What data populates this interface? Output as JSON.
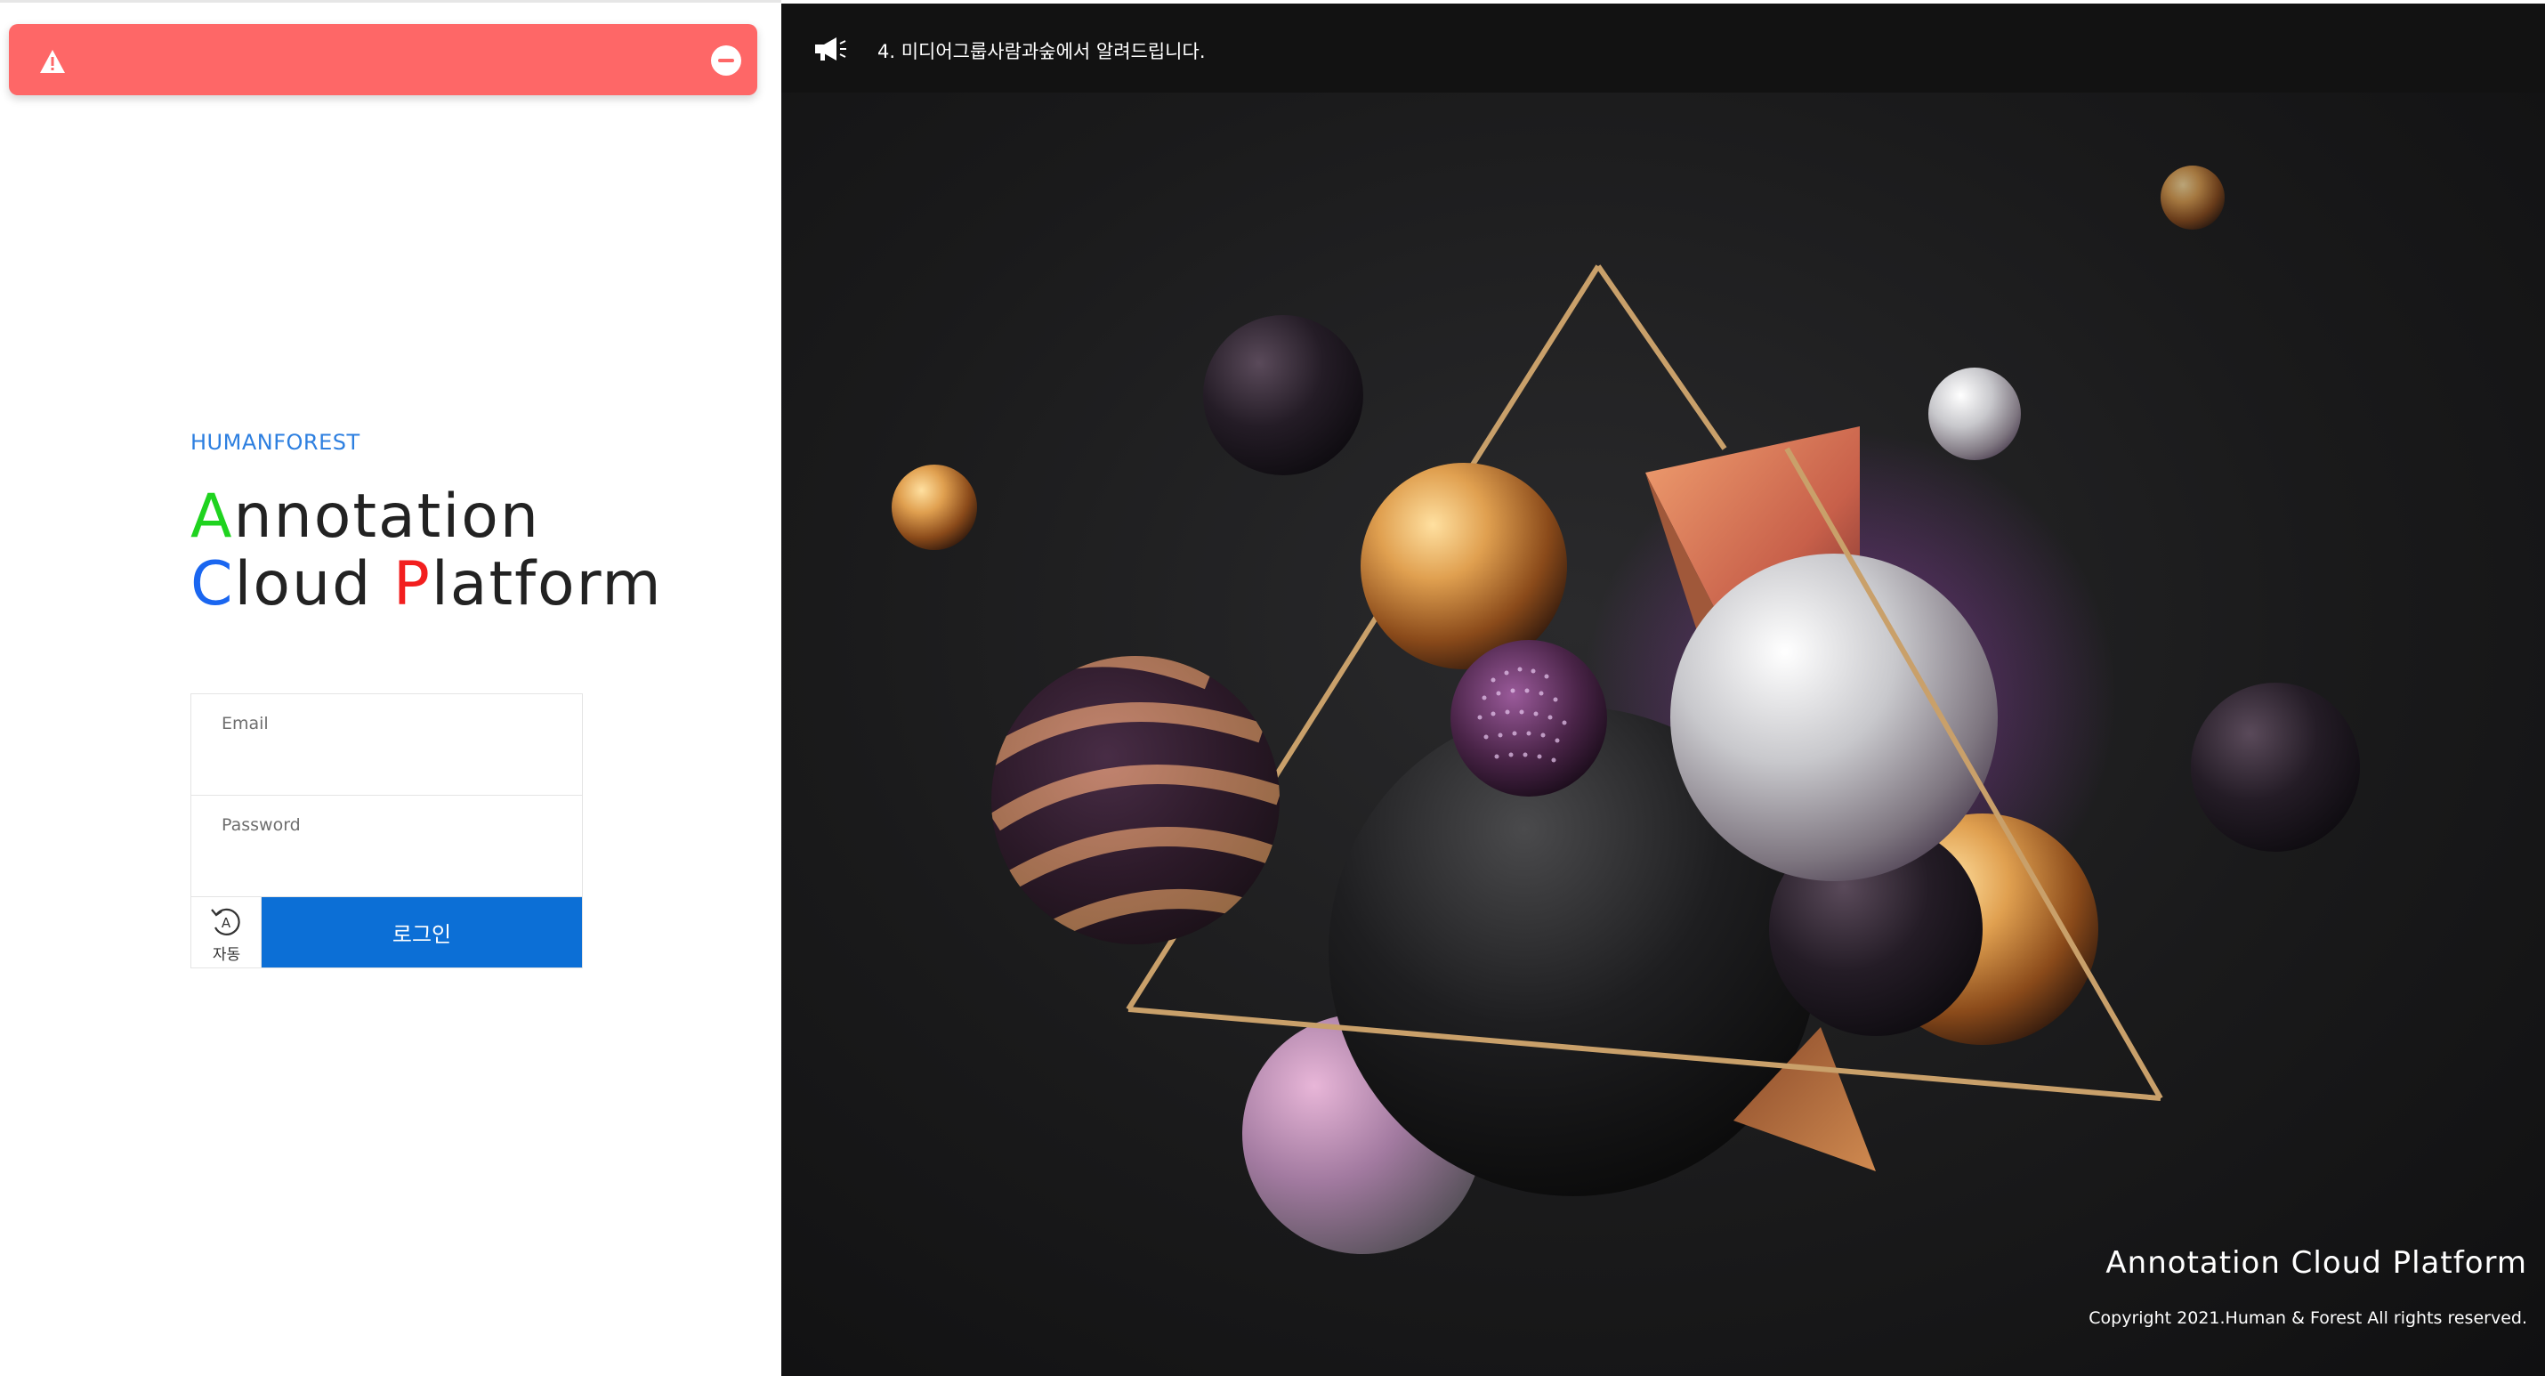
{
  "alert": {
    "icon": "warning-icon",
    "close_icon": "minus-circle-icon",
    "color": "#fe6767"
  },
  "login": {
    "brand": "HUMANFOREST",
    "title_line1_first": "A",
    "title_line1_rest": "nnotation",
    "title_line2_c": "C",
    "title_line2_loud": "loud ",
    "title_line2_p": "P",
    "title_line2_rest": "latform",
    "email_label": "Email",
    "email_value": "",
    "password_label": "Password",
    "password_value": "",
    "auto_label": "자동",
    "auto_icon": "auto-login-icon",
    "login_button": "로그인",
    "accent_color": "#0c6fd6"
  },
  "notice": {
    "icon": "megaphone-icon",
    "text": "4. 미디어그룹사람과숲에서 알려드립니다."
  },
  "footer": {
    "title": "Annotation Cloud Platform",
    "copyright": "Copyright 2021.Human & Forest All rights reserved."
  }
}
